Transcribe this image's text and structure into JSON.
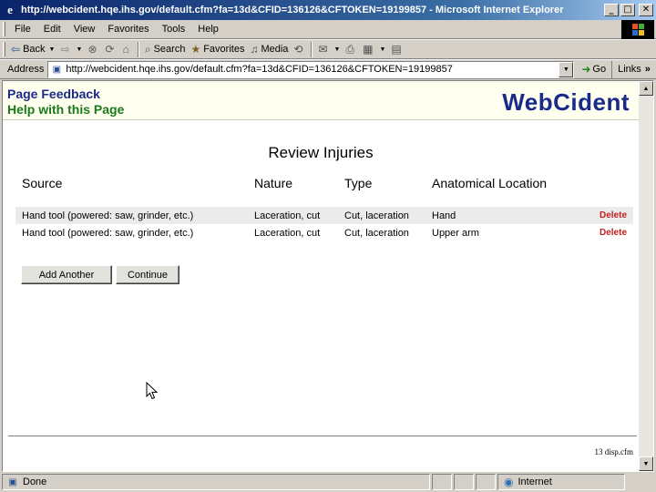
{
  "window": {
    "title": "http://webcident.hqe.ihs.gov/default.cfm?fa=13d&CFID=136126&CFTOKEN=19199857 - Microsoft Internet Explorer",
    "minimize": "_",
    "maximize": "□",
    "close": "✕"
  },
  "menu": [
    "File",
    "Edit",
    "View",
    "Favorites",
    "Tools",
    "Help"
  ],
  "toolbar": {
    "back": "Back",
    "search": "Search",
    "favorites": "Favorites",
    "media": "Media"
  },
  "address": {
    "label": "Address",
    "url": "http://webcident.hqe.ihs.gov/default.cfm?fa=13d&CFID=136126&CFTOKEN=19199857",
    "go": "Go",
    "links": "Links"
  },
  "page": {
    "feedback_link": "Page Feedback",
    "help_link": "Help with this Page",
    "brand": "WebCident",
    "heading": "Review Injuries",
    "columns": {
      "source": "Source",
      "nature": "Nature",
      "type": "Type",
      "location": "Anatomical Location"
    },
    "rows": [
      {
        "source": "Hand tool (powered: saw, grinder, etc.)",
        "nature": "Laceration, cut",
        "type": "Cut, laceration",
        "location": "Hand",
        "action": "Delete"
      },
      {
        "source": "Hand tool (powered: saw, grinder, etc.)",
        "nature": "Laceration, cut",
        "type": "Cut, laceration",
        "location": "Upper arm",
        "action": "Delete"
      }
    ],
    "add_button": "Add Another",
    "continue_button": "Continue",
    "page_id": "13 disp.cfm"
  },
  "status": {
    "text": "Done",
    "zone": "Internet"
  },
  "colors": {
    "titlebar": "#0a246a",
    "brand": "#1a2a8a",
    "help": "#1a7a1a",
    "delete": "#c02020"
  }
}
